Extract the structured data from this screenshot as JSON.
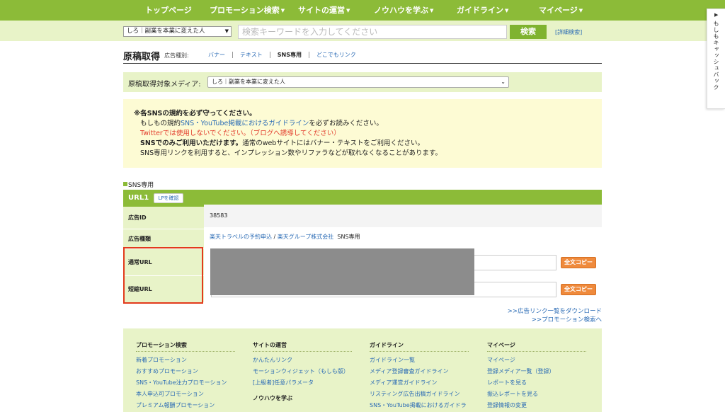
{
  "topnav": {
    "items": [
      {
        "label": "トップページ",
        "caret": false
      },
      {
        "label": "プロモーション検索",
        "caret": true
      },
      {
        "label": "サイトの運営",
        "caret": true
      },
      {
        "label": "ノウハウを学ぶ",
        "caret": true
      },
      {
        "label": "ガイドライン",
        "caret": true
      },
      {
        "label": "マイページ",
        "caret": true
      }
    ]
  },
  "searchbar": {
    "media_value": "しろ｜副業を本業に変えた人",
    "placeholder": "検索キーワードを入力してください",
    "search_label": "検索",
    "advanced_label": "[詳細検索]"
  },
  "side_tab": {
    "label": "もしもキャッシュバック"
  },
  "page": {
    "title": "原稿取得",
    "type_label": "広告種別:",
    "type_tabs": [
      "バナー",
      "テキスト",
      "SNS専用",
      "どこでもリンク"
    ],
    "active_tab": "SNS専用"
  },
  "media_row": {
    "label": "原稿取得対象メディア:",
    "value": "しろ｜副業を本業に変えた人"
  },
  "notice": {
    "l1": "※各SNSの規約を必ず守ってください。",
    "l2a": "もしもの規約",
    "l2link": "SNS・YouTube掲載におけるガイドライン",
    "l2b": "を必ずお読みください。",
    "l3": "Twitterでは使用しないでください。（ブログへ誘導してください）",
    "l4a": "SNSでのみご利用いただけます。",
    "l4b": "通常のwebサイトにはバナー・テキストをご利用ください。",
    "l5": "SNS専用リンクを利用すると、インプレッション数やリファラなどが取れなくなることがあります。"
  },
  "section": {
    "label": "SNS専用",
    "url_num": "URL1",
    "lp_label": "LPを確認",
    "rows": {
      "id_label": "広告ID",
      "id_value": "38583",
      "type_label": "広告種類",
      "type_link1": "楽天トラベルの予約申込",
      "type_sep": " / ",
      "type_link2": "楽天グループ株式会社",
      "type_suffix": "SNS専用",
      "normal_label": "通常URL",
      "short_label": "短縮URL",
      "copy_label": "全文コピー"
    }
  },
  "links": {
    "download": ">>広告リンク一覧をダウンロード",
    "promo": ">>プロモーション検索へ"
  },
  "footer": {
    "col1": {
      "heading": "プロモーション検索",
      "items": [
        "新着プロモーション",
        "おすすめプロモーション",
        "SNS・YouTube注力プロモーション",
        "本人申込可プロモーション",
        "プレミアム報酬プロモーション"
      ]
    },
    "col2": {
      "heading": "サイトの運営",
      "items": [
        "かんたんリンク",
        "モーションウィジェット（もしも版）",
        "[上級者]任意パラメータ"
      ],
      "heading2": "ノウハウを学ぶ"
    },
    "col3": {
      "heading": "ガイドライン",
      "items": [
        "ガイドライン一覧",
        "メディア登録審査ガイドライン",
        "メディア運営ガイドライン",
        "リスティング広告出稿ガイドライン",
        "SNS・YouTube掲載におけるガイドラ"
      ]
    },
    "col4": {
      "heading": "マイページ",
      "items": [
        "マイページ",
        "登録メディア一覧（登録）",
        "レポートを見る",
        "振込レポートを見る",
        "登録情報の変更"
      ]
    }
  }
}
